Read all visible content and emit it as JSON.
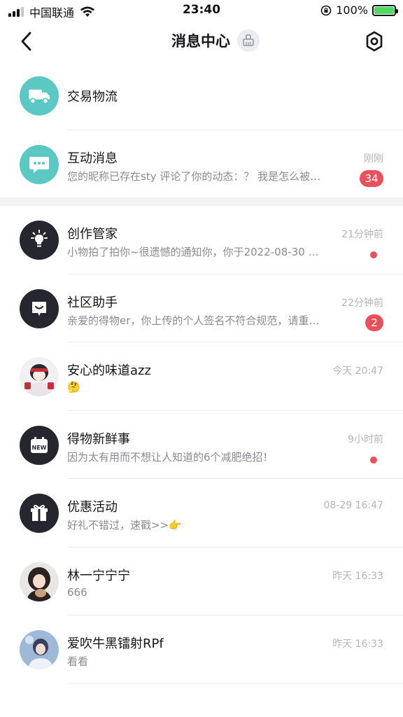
{
  "status_bar": {
    "carrier": "中国联通",
    "time": "23:40",
    "battery_pct": "100%"
  },
  "nav": {
    "title": "消息中心",
    "back_icon": "chevron-left-icon",
    "clear_icon": "broom-icon",
    "settings_icon": "hexagon-gear-icon"
  },
  "top_entries": [
    {
      "title": "交易物流",
      "icon": "truck-icon",
      "color": "#5cc8c4"
    },
    {
      "title": "互动消息",
      "subtitle": "您的昵称已存在sty 评论了你的动态：？ 我是怎么被…",
      "time": "刚刚",
      "badge": "34",
      "icon": "chat-bubble-icon",
      "color": "#5cc8c4"
    }
  ],
  "messages": [
    {
      "title": "创作管家",
      "subtitle": "小物拍了拍你~很遗憾的通知你，你于2022-08-30 …",
      "time": "21分钟前",
      "unread_dot": true,
      "icon": "lightbulb-icon"
    },
    {
      "title": "社区助手",
      "subtitle": "亲爱的得物er，你上传的个人签名不符合规范，请重…",
      "time": "22分钟前",
      "badge": "2",
      "icon": "smile-chat-icon"
    },
    {
      "title": "安心的味道azz",
      "subtitle": "🤔",
      "time": "今天 20:47",
      "icon": "user-avatar-cartoon"
    },
    {
      "title": "得物新鲜事",
      "subtitle": "因为太有用而不想让人知道的6个减肥绝招！",
      "time": "9小时前",
      "unread_dot": true,
      "icon": "new-calendar-icon",
      "icon_label": "NEW"
    },
    {
      "title": "优惠活动",
      "subtitle": "好礼不错过，速戳>>👉",
      "time": "08-29 16:47",
      "icon": "gift-icon"
    },
    {
      "title": "林一宁宁宁",
      "subtitle": "666",
      "time": "昨天 16:33",
      "icon": "user-avatar-photo"
    },
    {
      "title": "爱吹牛黑镭射RPf",
      "subtitle": "看看",
      "time": "昨天 16:33",
      "icon": "user-avatar-photo"
    }
  ],
  "colors": {
    "teal": "#5cc8c4",
    "dark_icon_bg": "#26262f",
    "badge_red": "#e8505b",
    "battery_green": "#4cd964"
  }
}
